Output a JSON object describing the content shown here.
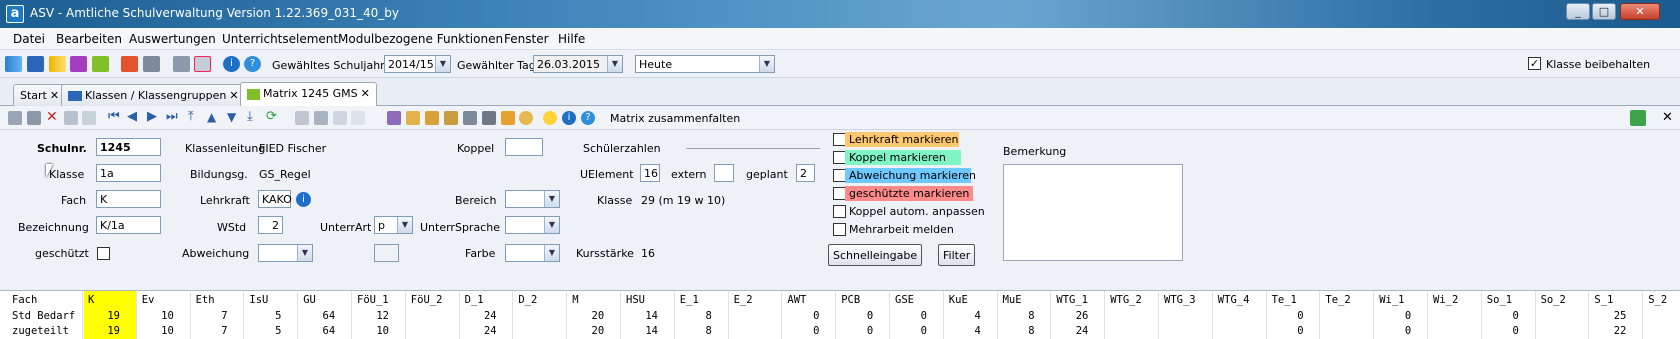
{
  "window": {
    "title": "ASV - Amtliche Schulverwaltung Version 1.22.369_031_40_by",
    "app_icon_letter": "a",
    "minimize": "_",
    "maximize": "□",
    "close": "✕"
  },
  "menu": [
    "Datei",
    "Bearbeiten",
    "Auswertungen",
    "Unterrichtselement",
    "Modulbezogene Funktionen",
    "Fenster",
    "Hilfe"
  ],
  "toolbar": {
    "schuljahr_label": "Gewähltes Schuljahr",
    "schuljahr_value": "2014/15",
    "tag_label": "Gewählter Tag",
    "tag_value": "26.03.2015",
    "heute_value": "Heute",
    "klasse_beibehalten_label": "Klasse beibehalten",
    "klasse_beibehalten_checked": "✓"
  },
  "tabs": [
    {
      "label": "Start",
      "close": "✕"
    },
    {
      "label": "Klassen / Klassengruppen",
      "close": "✕"
    },
    {
      "label": "Matrix 1245 GMS",
      "close": "✕"
    }
  ],
  "toolbar2": {
    "matrix_button": "Matrix zusammenfalten",
    "close_x": "✕"
  },
  "form": {
    "schulnr_label": "Schulnr.",
    "schulnr_value": "1245",
    "klasse_label": "Klasse",
    "klasse_value": "1a",
    "fach_label": "Fach",
    "fach_value": "K",
    "bezeichnung_label": "Bezeichnung",
    "bezeichnung_value": "K/1a",
    "geschuetzt_label": "geschützt",
    "klassenleitung_label": "Klassenleitung",
    "klassenleitung_value": "FIED Fischer",
    "bildungsg_label": "Bildungsg.",
    "bildungsg_value": "GS_Regel",
    "lehrkraft_label": "Lehrkraft",
    "lehrkraft_value": "KAKO",
    "wstd_label": "WStd",
    "wstd_value": "2",
    "unterrart_label": "UnterrArt",
    "unterrart_value": "p",
    "abweichung_label": "Abweichung",
    "koppel_label": "Koppel",
    "bereich_label": "Bereich",
    "unterrsprache_label": "UnterrSprache",
    "farbe_label": "Farbe",
    "schuelerzahlen_label": "Schülerzahlen",
    "uelement_label": "UElement",
    "uelement_value": "16",
    "extern_label": "extern",
    "geplant_label": "geplant",
    "geplant_value": "2",
    "klasse2_label": "Klasse",
    "klasse2_value": "29 (m 19 w 10)",
    "kursstaerke_label": "Kursstärke",
    "kursstaerke_value": "16",
    "bemerkung_label": "Bemerkung",
    "markers": [
      {
        "label": "Lehrkraft markieren",
        "color": "#ffc86e"
      },
      {
        "label": "Koppel markieren",
        "color": "#7ff5c4"
      },
      {
        "label": "Abweichung markieren",
        "color": "#6fc8ff"
      },
      {
        "label": "geschützte markieren",
        "color": "#ff8a8a"
      },
      {
        "label": "Koppel autom. anpassen",
        "color": ""
      },
      {
        "label": "Mehrarbeit melden",
        "color": ""
      }
    ],
    "schnelleingabe_button": "Schnelleingabe",
    "filter_button": "Filter"
  },
  "matrix": {
    "row_labels": [
      "Fach",
      "Std Bedarf",
      "zugeteilt"
    ],
    "columns": [
      {
        "h": "K",
        "b": "19",
        "z": "19"
      },
      {
        "h": "Ev",
        "b": "10",
        "z": "10"
      },
      {
        "h": "Eth",
        "b": "7",
        "z": "7"
      },
      {
        "h": "IsU",
        "b": "5",
        "z": "5"
      },
      {
        "h": "GU",
        "b": "64",
        "z": "64"
      },
      {
        "h": "FöU_1",
        "b": "12",
        "z": "10"
      },
      {
        "h": "FöU_2",
        "b": "",
        "z": ""
      },
      {
        "h": "D_1",
        "b": "24",
        "z": "24"
      },
      {
        "h": "D_2",
        "b": "",
        "z": ""
      },
      {
        "h": "M",
        "b": "20",
        "z": "20"
      },
      {
        "h": "HSU",
        "b": "14",
        "z": "14"
      },
      {
        "h": "E_1",
        "b": "8",
        "z": "8"
      },
      {
        "h": "E_2",
        "b": "",
        "z": ""
      },
      {
        "h": "AWT",
        "b": "0",
        "z": "0"
      },
      {
        "h": "PCB",
        "b": "0",
        "z": "0"
      },
      {
        "h": "GSE",
        "b": "0",
        "z": "0"
      },
      {
        "h": "KuE",
        "b": "4",
        "z": "4"
      },
      {
        "h": "MuE",
        "b": "8",
        "z": "8"
      },
      {
        "h": "WTG_1",
        "b": "26",
        "z": "24"
      },
      {
        "h": "WTG_2",
        "b": "",
        "z": ""
      },
      {
        "h": "WTG_3",
        "b": "",
        "z": ""
      },
      {
        "h": "WTG_4",
        "b": "",
        "z": ""
      },
      {
        "h": "Te_1",
        "b": "0",
        "z": "0"
      },
      {
        "h": "Te_2",
        "b": "",
        "z": ""
      },
      {
        "h": "Wi_1",
        "b": "0",
        "z": "0"
      },
      {
        "h": "Wi_2",
        "b": "",
        "z": ""
      },
      {
        "h": "So_1",
        "b": "0",
        "z": "0"
      },
      {
        "h": "So_2",
        "b": "",
        "z": ""
      },
      {
        "h": "S_1",
        "b": "25",
        "z": "22"
      },
      {
        "h": "S_2",
        "b": "",
        "z": ""
      }
    ]
  }
}
